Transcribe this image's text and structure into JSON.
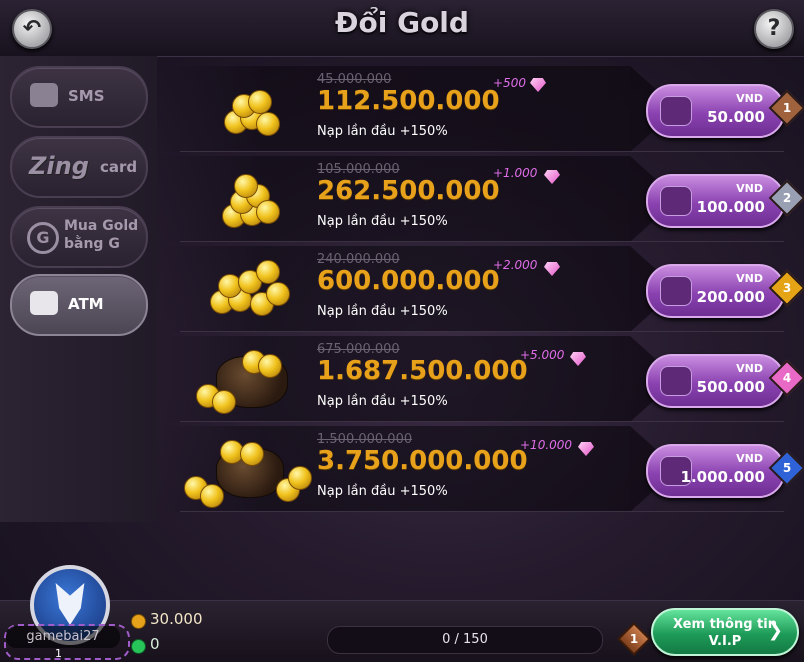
{
  "header": {
    "title": "Đổi Gold",
    "back_icon": "back-arrow-icon",
    "help_label": "?"
  },
  "sidebar": {
    "items": [
      {
        "label": "SMS",
        "icon": "sms-icon",
        "active": false
      },
      {
        "label_brand": "Zing",
        "label": "card",
        "icon": "zing-logo",
        "active": false
      },
      {
        "label_line1": "Mua Gold",
        "label_line2": "bằng G",
        "icon": "g-coin-icon",
        "active": false
      },
      {
        "label": "ATM",
        "icon": "atm-card-icon",
        "active": true
      }
    ]
  },
  "packages": [
    {
      "old_amount": "45.000.000",
      "amount": "112.500.000",
      "promo": "Nạp lần đầu  +150%",
      "bonus": "+500",
      "currency": "VND",
      "price": "50.000",
      "tier": "1",
      "tier_color": "#a0623c"
    },
    {
      "old_amount": "105.000.000",
      "amount": "262.500.000",
      "promo": "Nạp lần đầu  +150%",
      "bonus": "+1.000",
      "currency": "VND",
      "price": "100.000",
      "tier": "2",
      "tier_color": "#9aa0b4"
    },
    {
      "old_amount": "240.000.000",
      "amount": "600.000.000",
      "promo": "Nạp lần đầu  +150%",
      "bonus": "+2.000",
      "currency": "VND",
      "price": "200.000",
      "tier": "3",
      "tier_color": "#e5a416"
    },
    {
      "old_amount": "675.000.000",
      "amount": "1.687.500.000",
      "promo": "Nạp lần đầu  +150%",
      "bonus": "+5.000",
      "currency": "VND",
      "price": "500.000",
      "tier": "4",
      "tier_color": "#e96ac6"
    },
    {
      "old_amount": "1.500.000.000",
      "amount": "3.750.000.000",
      "promo": "Nạp lần đầu  +150%",
      "bonus": "+10.000",
      "currency": "VND",
      "price": "1.000.000",
      "tier": "5",
      "tier_color": "#2e62d6"
    }
  ],
  "footer": {
    "username": "gamebai27",
    "level": "1",
    "gold": "30.000",
    "g_balance": "0",
    "xp_text": "0 / 150",
    "xp_progress": 0,
    "tier": "1",
    "vip_line1": "Xem thông tin",
    "vip_line2": "V.I.P"
  }
}
